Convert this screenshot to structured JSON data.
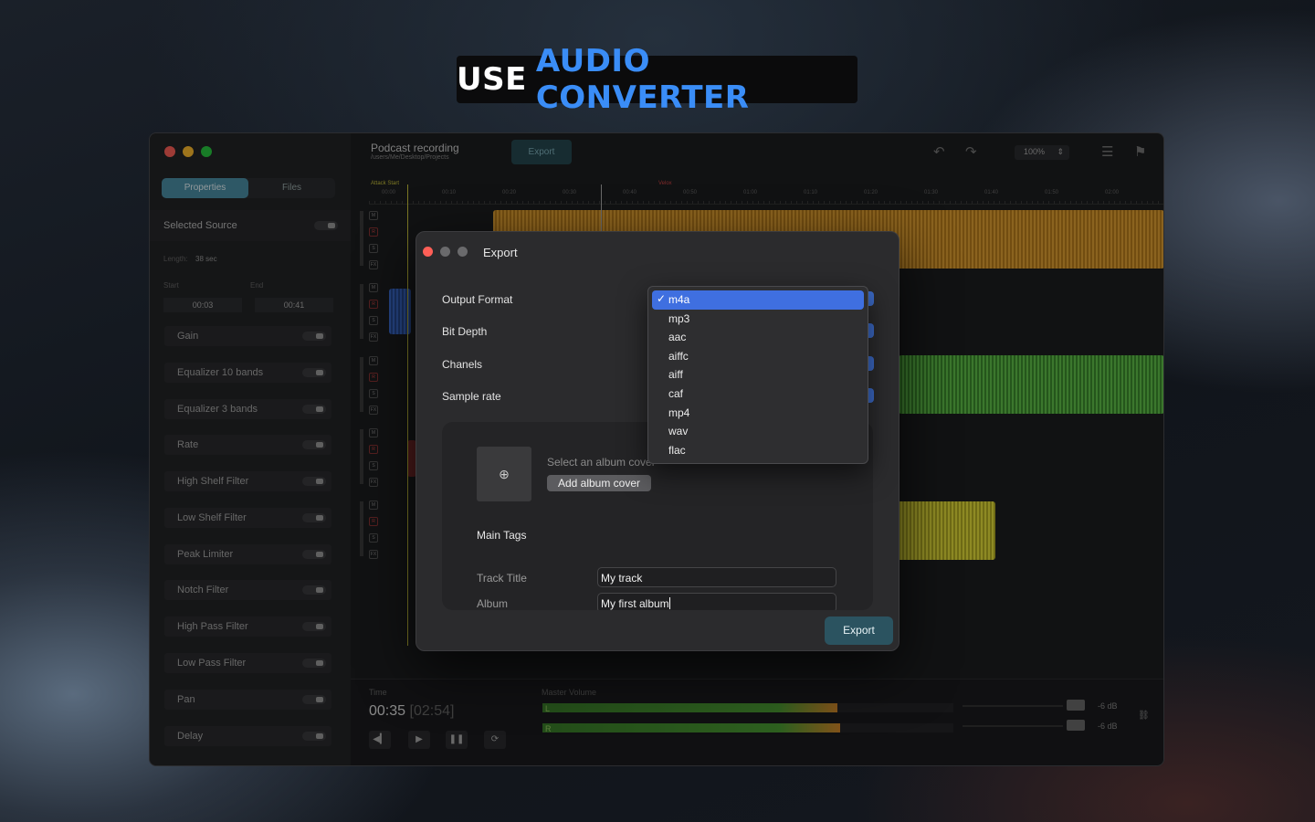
{
  "headline": {
    "part1": "USE",
    "part2": "AUDIO CONVERTER"
  },
  "window": {
    "project_title": "Podcast recording",
    "project_path": "/users/Me/Desktop/Projects",
    "toolbar_export": "Export",
    "zoom": "100%",
    "undo_icon": "undo-icon",
    "redo_icon": "redo-icon"
  },
  "sidebar": {
    "tabs": [
      "Properties",
      "Files"
    ],
    "selected_source": "Selected Source",
    "length_label": "Length:",
    "length_value": "38 sec",
    "start_label": "Start",
    "end_label": "End",
    "start_value": "00:03",
    "end_value": "00:41",
    "effects": [
      "Gain",
      "Equalizer 10 bands",
      "Equalizer 3 bands",
      "Rate",
      "High Shelf Filter",
      "Low Shelf Filter",
      "Peak Limiter",
      "Notch Filter",
      "High Pass Filter",
      "Low Pass Filter",
      "Pan",
      "Delay"
    ]
  },
  "timeline": {
    "ticks": [
      "00:00",
      "00:10",
      "00:20",
      "00:30",
      "00:40",
      "00:50",
      "01:00",
      "01:10",
      "01:20",
      "01:30",
      "01:40",
      "01:50",
      "02:00"
    ],
    "attack_start": "Attack Start",
    "marker2": "Velox",
    "track_buttons": [
      "M",
      "R",
      "S",
      "FX"
    ]
  },
  "bottom": {
    "time_label": "Time",
    "time_current": "00:35",
    "time_total": "[02:54]",
    "master_volume_label": "Master Volume",
    "channel_l": "L",
    "channel_r": "R",
    "db_l": "-6 dB",
    "db_r": "-6 dB",
    "master_level_l": 0.95,
    "master_level_r": 0.96
  },
  "dialog": {
    "title": "Export",
    "output_format_label": "Output Format",
    "bit_depth_label": "Bit Depth",
    "channels_label": "Chanels",
    "sample_rate_label": "Sample rate",
    "album_cover_hint": "Select an album cover",
    "add_album_cover": "Add album cover",
    "main_tags": "Main Tags",
    "track_title_label": "Track Title",
    "track_title_value": "My track",
    "album_label": "Album",
    "album_value": "My first album",
    "export_button": "Export",
    "format_options": [
      "m4a",
      "mp3",
      "aac",
      "aiffc",
      "aiff",
      "caf",
      "mp4",
      "wav",
      "flac"
    ],
    "selected_format": "m4a",
    "check_mark": "✓"
  },
  "colors": {
    "accent": "#3a8df7",
    "selection": "#3f6fe0",
    "export_button": "#2b5360"
  }
}
